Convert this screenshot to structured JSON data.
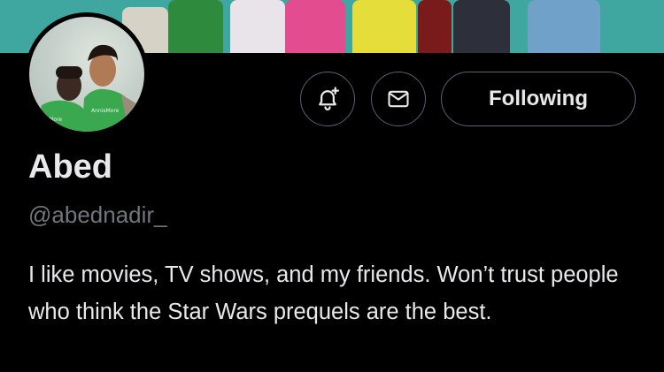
{
  "profile": {
    "name": "Abed",
    "handle": "@abednadir_",
    "bio": "I like movies, TV shows, and my friends. Won’t trust people who think the Star Wars prequels are the best.",
    "avatar_shirt_text_left": "ssMore",
    "avatar_shirt_text_right": "AnnisMore"
  },
  "actions": {
    "follow_label": "Following",
    "notify_icon": "bell-plus-icon",
    "message_icon": "envelope-icon"
  },
  "colors": {
    "background": "#000000",
    "text_primary": "#e7e9ea",
    "text_secondary": "#71767b",
    "button_border": "#536471",
    "banner_bg": "#3fa7a0",
    "shirt_green": "#3aa84e"
  }
}
